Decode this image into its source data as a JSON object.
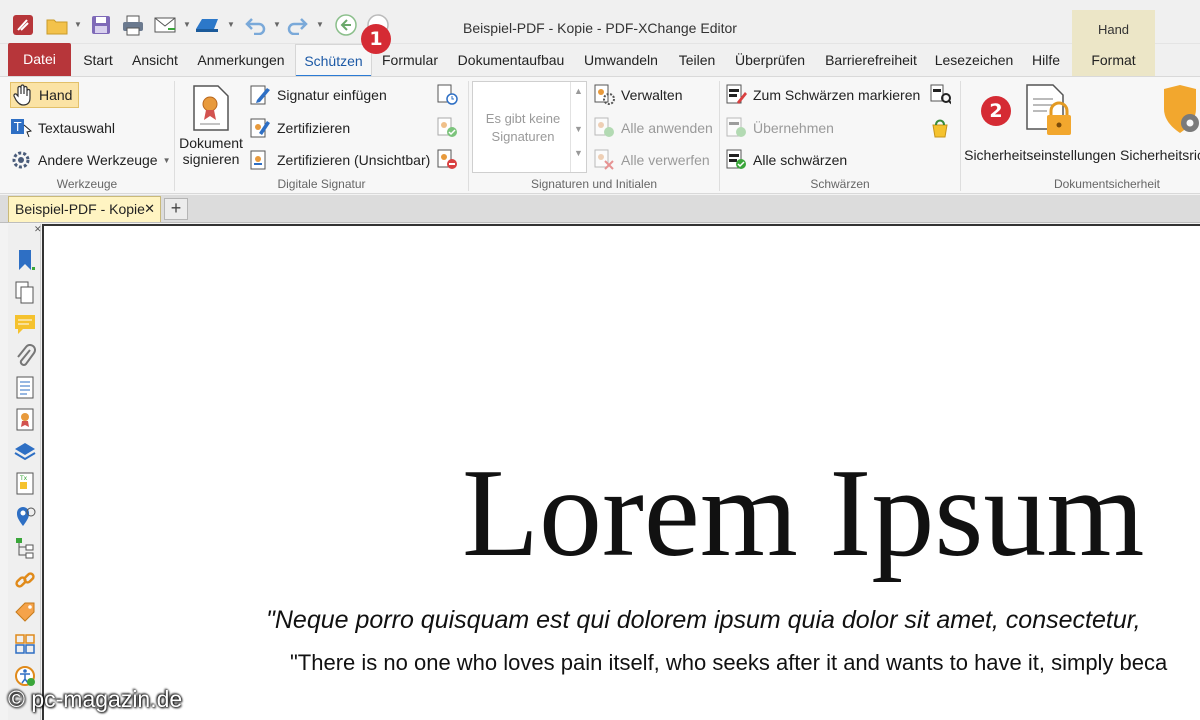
{
  "window": {
    "title": "Beispiel-PDF - Kopie - PDF-XChange Editor"
  },
  "context_tab": {
    "group_label": "Hand",
    "tab_label": "Format"
  },
  "tabs": [
    "Datei",
    "Start",
    "Ansicht",
    "Anmerkungen",
    "Schützen",
    "Formular",
    "Dokumentaufbau",
    "Umwandeln",
    "Teilen",
    "Überprüfen",
    "Barrierefreiheit",
    "Lesezeichen",
    "Hilfe"
  ],
  "ribbon": {
    "werkzeuge": {
      "label": "Werkzeuge",
      "hand": "Hand",
      "textauswahl": "Textauswahl",
      "andere": "Andere Werkzeuge"
    },
    "digitale_signatur": {
      "label": "Digitale Signatur",
      "dokument_signieren": "Dokument signieren",
      "signatur_einfuegen": "Signatur einfügen",
      "zertifizieren": "Zertifizieren",
      "zertifizieren_unsichtbar": "Zertifizieren (Unsichtbar)"
    },
    "signaturen": {
      "label": "Signaturen und Initialen",
      "empty": "Es gibt keine Signaturen",
      "verwalten": "Verwalten",
      "alle_anwenden": "Alle anwenden",
      "alle_verwerfen": "Alle verwerfen"
    },
    "schwaerzen": {
      "label": "Schwärzen",
      "markieren": "Zum Schwärzen markieren",
      "uebernehmen": "Übernehmen",
      "alle": "Alle schwärzen"
    },
    "dokumentsicherheit": {
      "label": "Dokumentsicherheit",
      "einstellungen": "Sicherheitseinstellungen",
      "richtlinien": "Sicherheitsric"
    }
  },
  "badges": {
    "one": "1",
    "two": "2"
  },
  "document": {
    "tab_title": "Beispiel-PDF - Kopie",
    "heading": "Lorem Ipsum",
    "quote": "\"Neque porro quisquam est qui dolorem ipsum quia dolor sit amet, consectetur,",
    "translation": "\"There is no one who loves pain itself, who seeks after it and wants to have it, simply beca"
  },
  "watermark": "© pc-magazin.de",
  "colors": {
    "accent": "#2b7bd5",
    "file_tab": "#b7363a",
    "badge": "#d52b34",
    "doc_tab": "#fff4c2"
  }
}
